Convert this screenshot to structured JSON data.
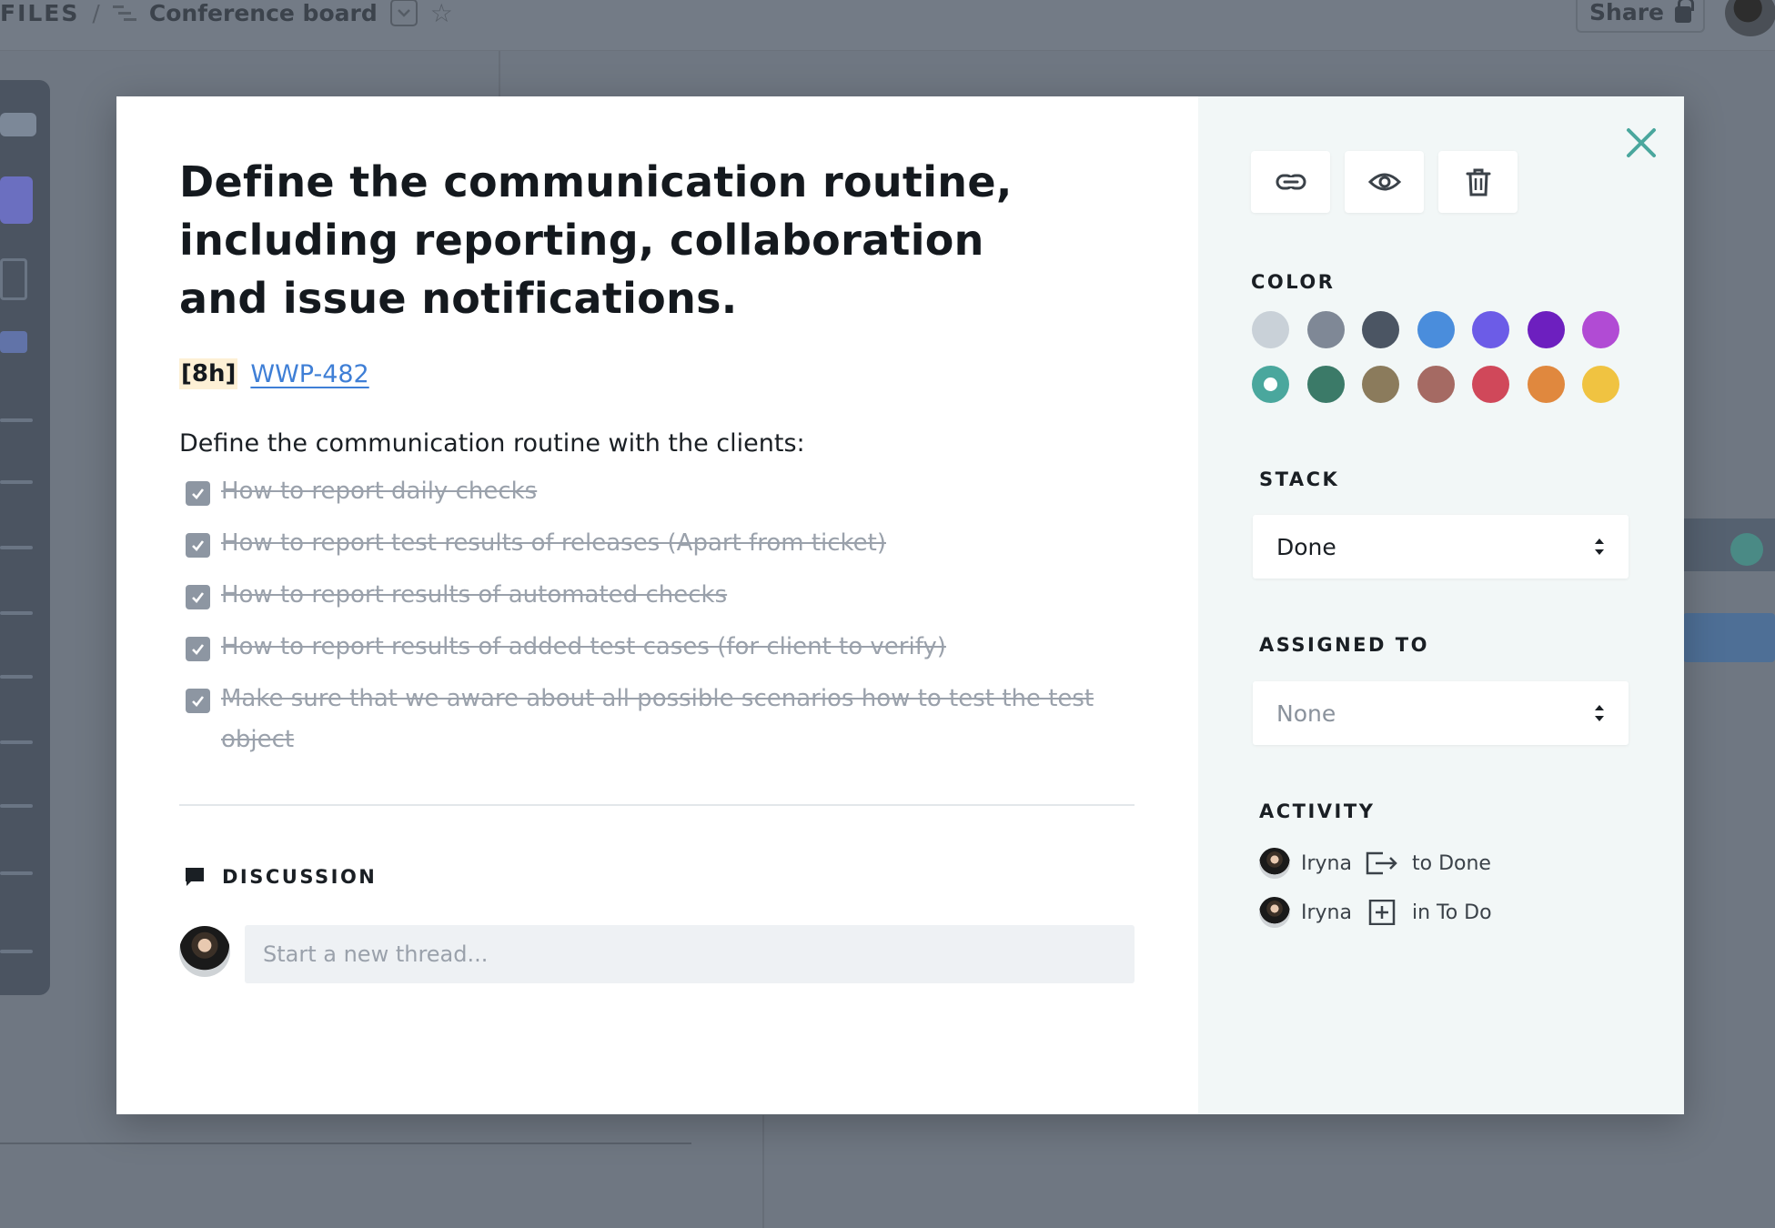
{
  "app": {
    "breadcrumb_root": "FILES",
    "breadcrumb_sep": "/",
    "board_title": "Conference board",
    "share_label": "Share"
  },
  "card": {
    "title": "Define the communication routine, including reporting, collaboration and issue notifications.",
    "estimate": "[8h]",
    "ticket": "WWP-482",
    "description": "Define the communication routine with the clients:",
    "checklist": [
      "How to report daily checks",
      "How to report test results of releases (Apart from ticket)",
      "How to report results of automated checks",
      "How to report results of added test cases (for client to verify)",
      "Make sure that we aware about all possible scenarios how to test the test object"
    ]
  },
  "discussion": {
    "label": "DISCUSSION",
    "placeholder": "Start a new thread..."
  },
  "sidebar": {
    "color_label": "COLOR",
    "colors": [
      "#c9d1d8",
      "#7f8896",
      "#4b5563",
      "#4a8ddc",
      "#6c5ce7",
      "#6d1fbf",
      "#b14bd4",
      "#4aa79d",
      "#3b7a68",
      "#8b7b5c",
      "#a56a63",
      "#d0485a",
      "#e0883e",
      "#f0c341"
    ],
    "selected_color": "#4aa79d",
    "stack_label": "STACK",
    "stack_value": "Done",
    "assigned_label": "ASSIGNED TO",
    "assigned_value": "None",
    "activity_label": "ACTIVITY",
    "activity": [
      {
        "user": "Iryna",
        "action_icon": "move-icon",
        "text": "to Done"
      },
      {
        "user": "Iryna",
        "action_icon": "add-box-icon",
        "text": "in To Do"
      }
    ]
  },
  "accent": "#4aa79d"
}
